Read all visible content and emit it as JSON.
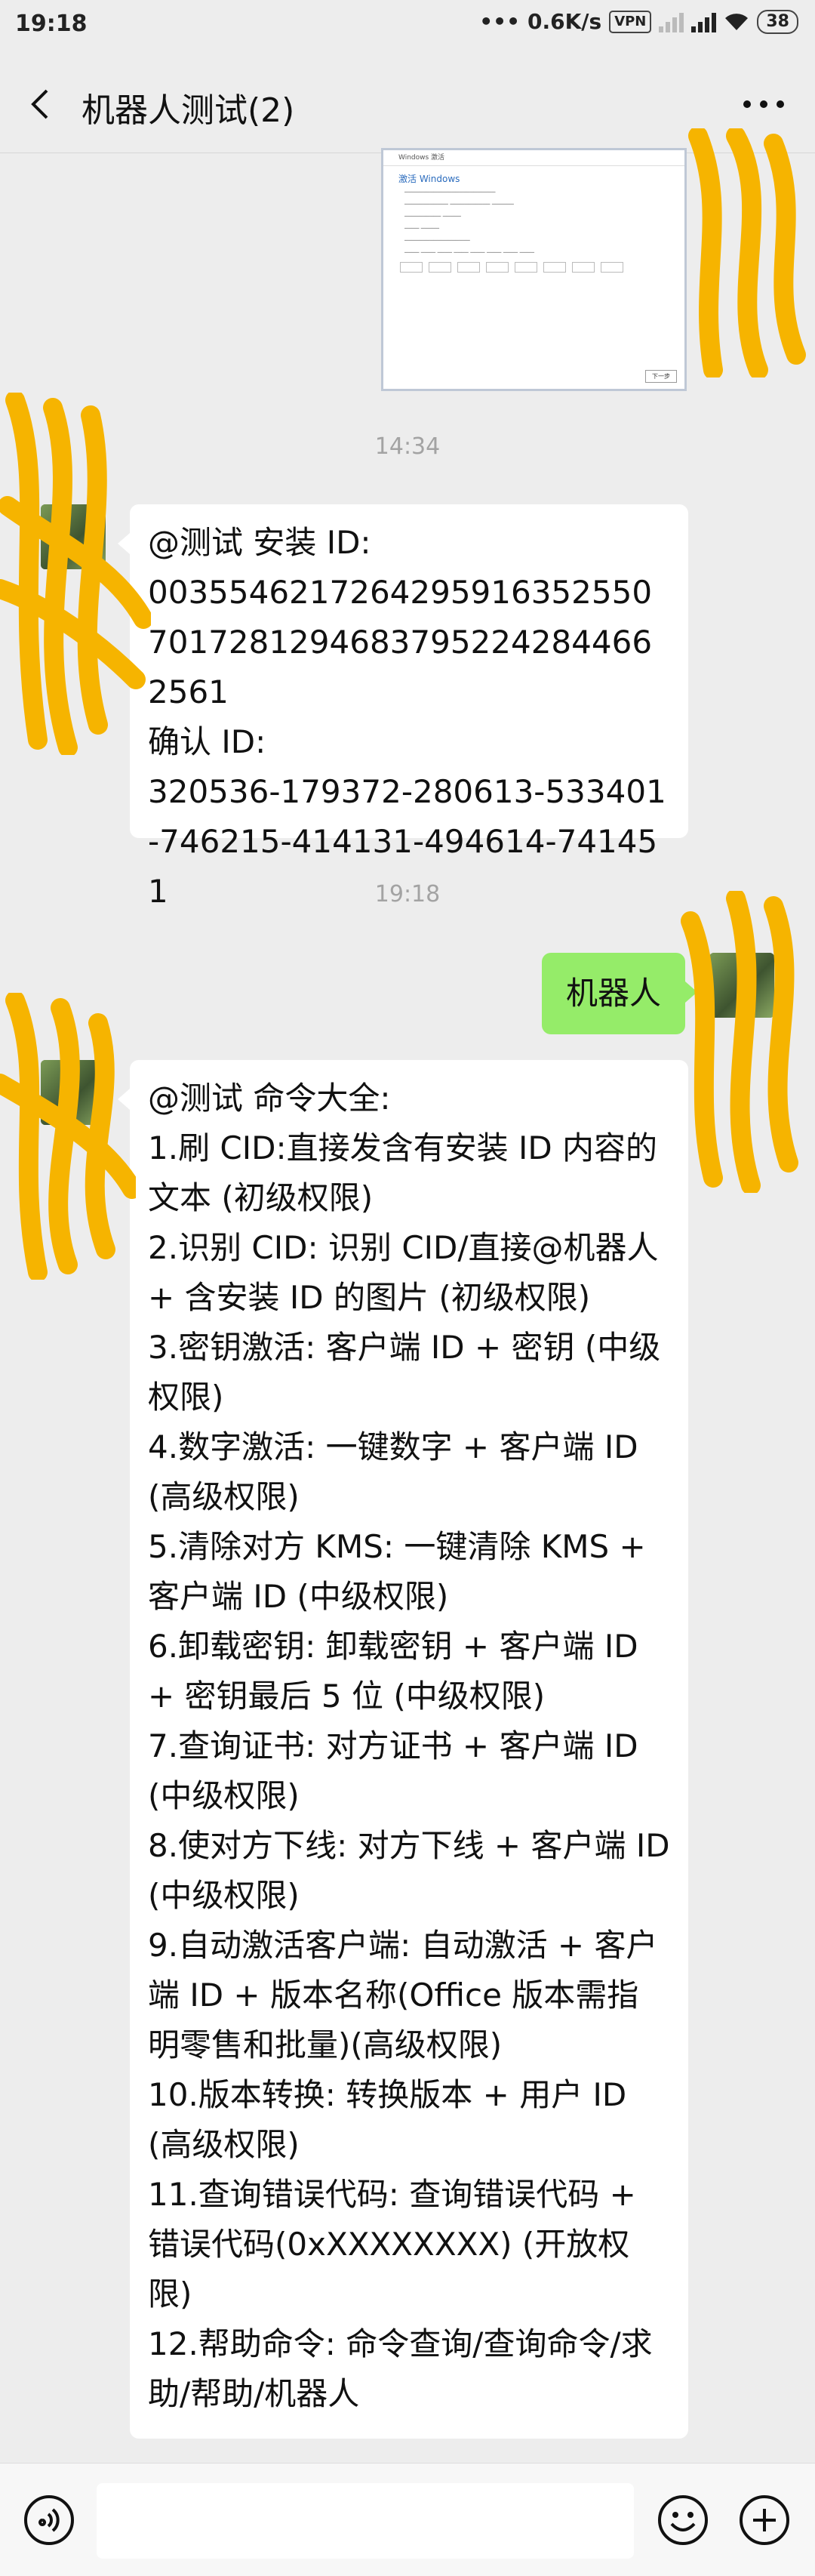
{
  "status_bar": {
    "time": "19:18",
    "speed": "0.6K/s",
    "vpn": "VPN",
    "battery": "38"
  },
  "header": {
    "title": "机器人测试(2)"
  },
  "chat": {
    "screenshot_image": {
      "window_title": "Windows 激活",
      "heading": "激活 Windows",
      "button": "下一步"
    },
    "timestamp_1": "14:34",
    "message_1": "@测试 安装 ID:\n003554621726429591635255070172812946837952242844662561\n确认 ID:\n320536-179372-280613-533401-746215-414131-494614-741451",
    "timestamp_2": "19:18",
    "message_2": "机器人",
    "message_3": "@测试 命令大全:\n1.刷 CID:直接发含有安装 ID 内容的文本 (初级权限)\n2.识别 CID: 识别 CID/直接@机器人 + 含安装 ID 的图片 (初级权限)\n3.密钥激活: 客户端 ID + 密钥 (中级权限)\n4.数字激活: 一键数字 + 客户端 ID (高级权限)\n5.清除对方 KMS: 一键清除 KMS + 客户端 ID (中级权限)\n6.卸载密钥: 卸载密钥 + 客户端 ID + 密钥最后 5 位 (中级权限)\n7.查询证书: 对方证书 + 客户端 ID (中级权限)\n8.使对方下线: 对方下线 + 客户端 ID (中级权限)\n9.自动激活客户端: 自动激活 + 客户端 ID + 版本名称(Office 版本需指明零售和批量)(高级权限)\n10.版本转换: 转换版本 + 用户 ID (高级权限)\n11.查询错误代码: 查询错误代码 + 错误代码(0xXXXXXXXX) (开放权限)\n12.帮助命令: 命令查询/查询命令/求助/帮助/机器人"
  },
  "input_bar": {
    "voice_icon": "voice-icon",
    "emoji_icon": "emoji-icon",
    "plus_icon": "plus-icon"
  },
  "colors": {
    "background": "#ededed",
    "sent_bubble": "#95ec69",
    "received_bubble": "#ffffff",
    "scribble": "#f6b400"
  }
}
